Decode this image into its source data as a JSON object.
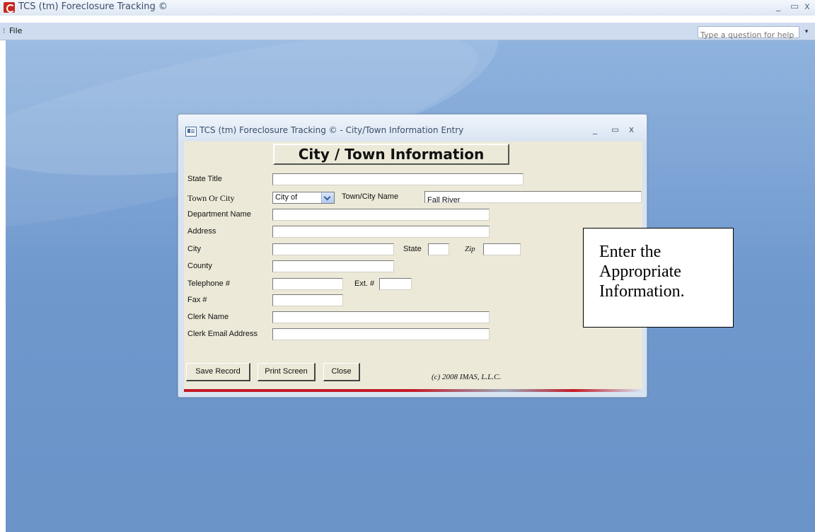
{
  "app": {
    "title": "TCS (tm) Foreclosure Tracking ©",
    "minimize": "_",
    "restore": "▭",
    "close": "x"
  },
  "menu": {
    "file": "File",
    "help_placeholder": "Type a question for help",
    "help_dropdown": "▾"
  },
  "form_window": {
    "title": "TCS (tm) Foreclosure Tracking © - City/Town Information Entry",
    "minimize": "_",
    "restore": "▭",
    "close": "x"
  },
  "form": {
    "header": "City / Town Information",
    "labels": {
      "state_title": "State Title",
      "town_or_city": "Town Or City",
      "town_city_name": "Town/City Name",
      "department_name": "Department Name",
      "address": "Address",
      "city": "City",
      "state": "State",
      "zip": "Zip",
      "county": "County",
      "telephone": "Telephone #",
      "ext": "Ext. #",
      "fax": "Fax #",
      "clerk_name": "Clerk Name",
      "clerk_email": "Clerk Email Address"
    },
    "values": {
      "state_title": "",
      "town_or_city": "City of",
      "town_city_name": "Fall River",
      "department_name": "",
      "address": "",
      "city": "",
      "state": "",
      "zip": "",
      "county": "",
      "telephone": "",
      "ext": "",
      "fax": "",
      "clerk_name": "",
      "clerk_email": ""
    },
    "buttons": {
      "save": "Save Record",
      "print": "Print Screen",
      "close": "Close"
    },
    "copyright": "(c) 2008 IMAS, L.L.C."
  },
  "callout": {
    "text": "Enter the\nAppropriate\nInformation."
  }
}
